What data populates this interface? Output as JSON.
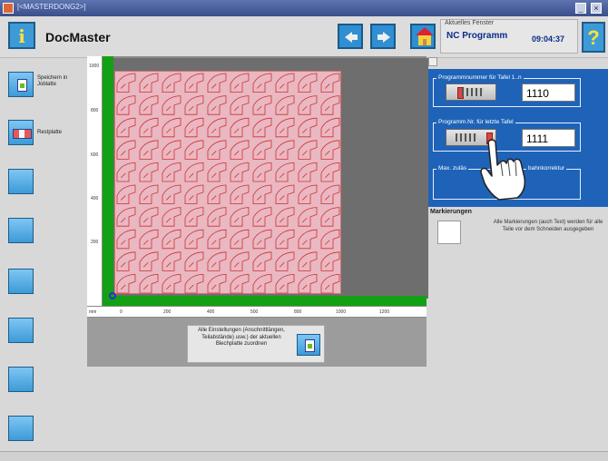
{
  "window": {
    "title": "[<MASTERDONG2>]"
  },
  "header": {
    "app_title": "DocMaster",
    "active_window_label": "Aktuelles Fenster",
    "active_window_name": "NC Programm",
    "clock": "09:04:37",
    "help_label": "?",
    "info_label": "i"
  },
  "sidebar": {
    "items": [
      {
        "label": "Speichern in Joblatte",
        "icon": "save-doc-icon"
      },
      {
        "label": "Restplatte",
        "icon": "remnant-plate-icon"
      },
      {
        "label": ""
      },
      {
        "label": ""
      },
      {
        "label": ""
      },
      {
        "label": ""
      },
      {
        "label": ""
      },
      {
        "label": ""
      }
    ]
  },
  "ruler": {
    "vertical": [
      "1000",
      "800",
      "600",
      "400",
      "200"
    ],
    "horizontal": [
      "0",
      "200",
      "400",
      "500",
      "800",
      "1000",
      "1200"
    ],
    "unit": "mm"
  },
  "parts": {
    "rows": 10,
    "cols": 10,
    "color": "#d03030"
  },
  "assign": {
    "text": "Alle Einstellungen (Anschnittlängen, Teilabstände) usw.) der aktuellen Blechplatte zuordnen"
  },
  "program": {
    "first_group_title": "Programmnummer für Tafel 1..n",
    "first_value": "1110",
    "last_group_title": "Programm.Nr. für letzte Tafel",
    "last_value": "1111",
    "correction_title_left": "Max. zuläs",
    "correction_title_right": "bahnkorrektur"
  },
  "markings": {
    "title": "Markierungen",
    "description": "Alle Markierungen (auch Text) werden für alle Teile vor dem Schneiden ausgegeben"
  },
  "colors": {
    "accent": "#1e63b8",
    "green": "#14a014",
    "part": "#d03030"
  }
}
